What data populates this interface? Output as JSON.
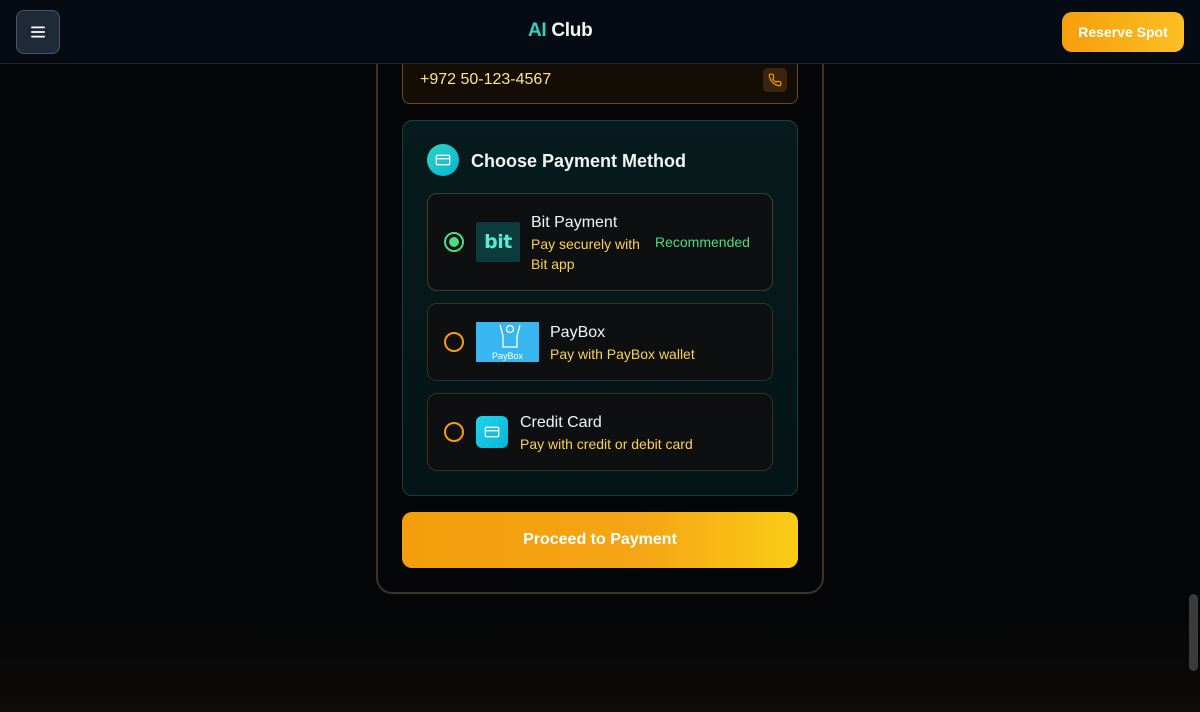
{
  "header": {
    "logo_ai": "AI",
    "logo_club": "Club",
    "reserve_label": "Reserve Spot"
  },
  "form": {
    "phone_value": "+972 50-123-4567"
  },
  "payment": {
    "title": "Choose Payment Method",
    "selected": "bit",
    "options": [
      {
        "id": "bit",
        "title": "Bit Payment",
        "description": "Pay securely with Bit app",
        "badge": "Recommended",
        "logo_text": "bit"
      },
      {
        "id": "paybox",
        "title": "PayBox",
        "description": "Pay with PayBox wallet",
        "logo_text": "PayBox"
      },
      {
        "id": "card",
        "title": "Credit Card",
        "description": "Pay with credit or debit card"
      }
    ]
  },
  "actions": {
    "proceed_label": "Proceed to Payment"
  },
  "colors": {
    "accent_amber": "#f59e0b",
    "accent_teal": "#2dd4bf",
    "success_green": "#4ade80"
  },
  "icons": {
    "menu": "hamburger-menu-icon",
    "phone": "phone-icon",
    "payment_header": "credit-card-icon",
    "card_option": "credit-card-icon"
  }
}
